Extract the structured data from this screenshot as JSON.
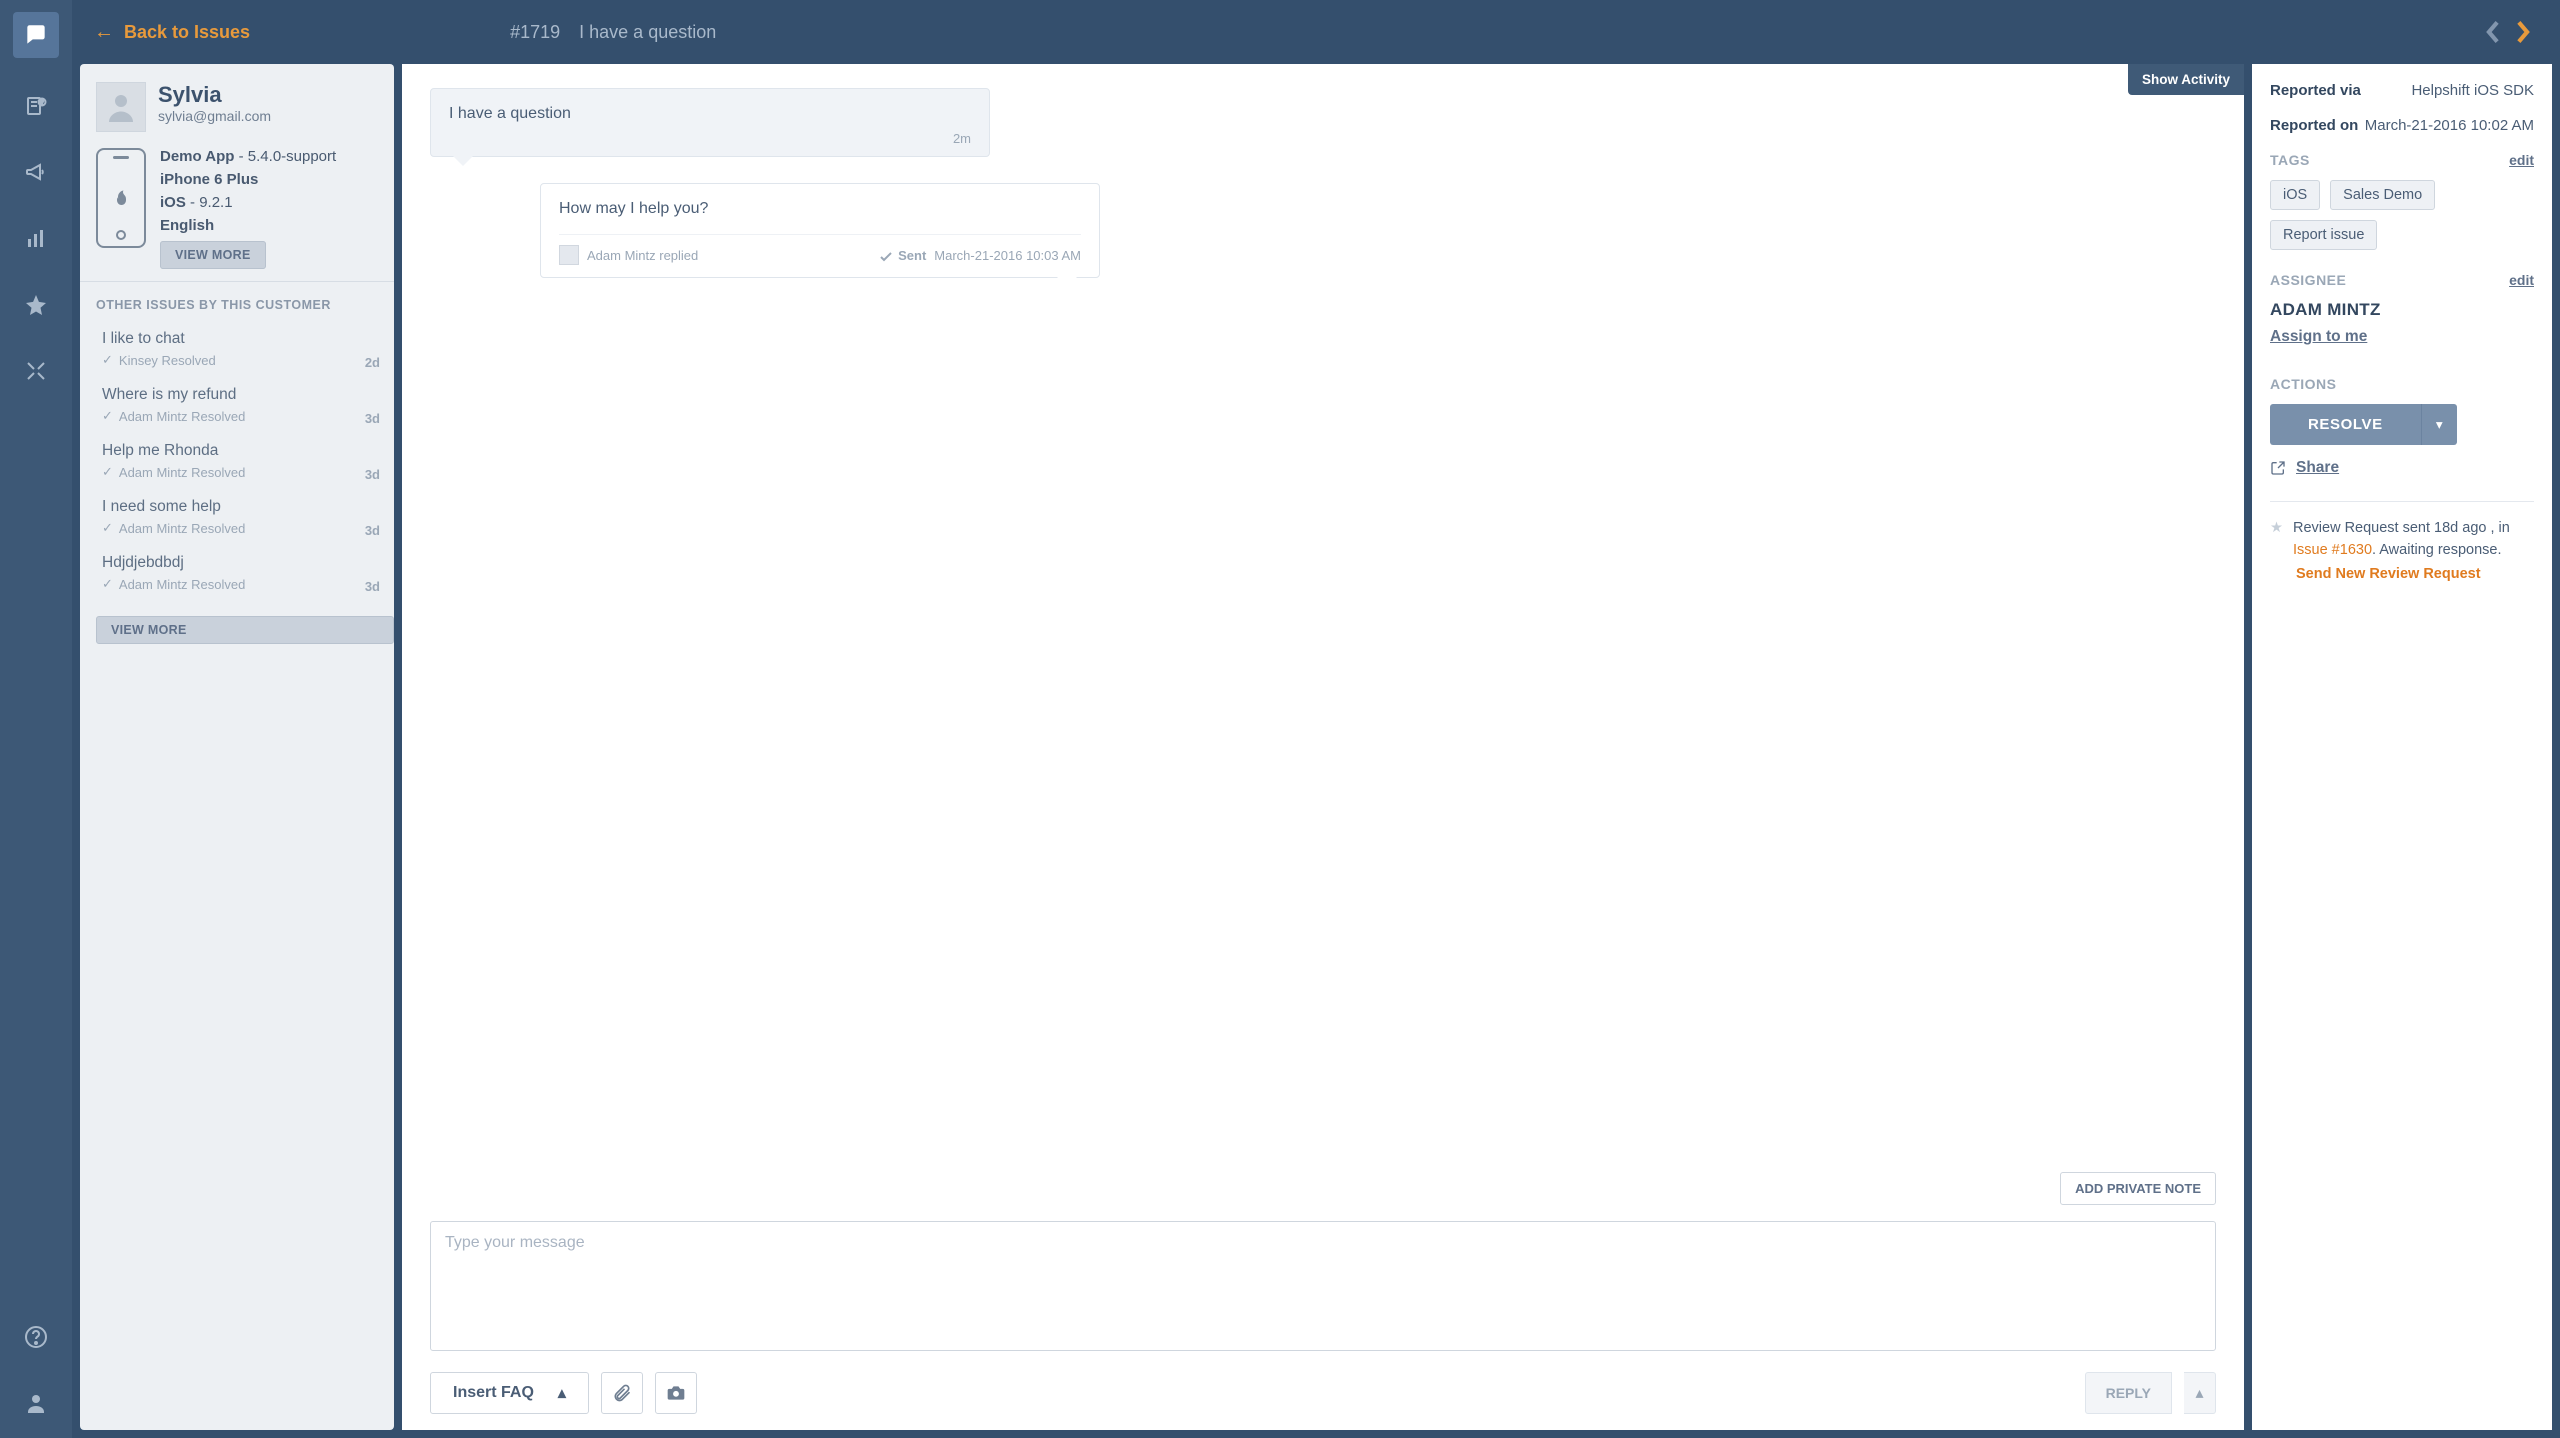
{
  "header": {
    "back_label": "Back to Issues",
    "issue_id": "#1719",
    "issue_title": "I have a question"
  },
  "customer": {
    "name": "Sylvia",
    "email": "sylvia@gmail.com",
    "app_name": "Demo App",
    "app_version": "5.4.0-support",
    "device": "iPhone 6 Plus",
    "os_name": "iOS",
    "os_version": "9.2.1",
    "language": "English",
    "view_more": "VIEW MORE"
  },
  "other_issues_label": "OTHER ISSUES BY THIS CUSTOMER",
  "other_issues": [
    {
      "title": "I like to chat",
      "meta": "Kinsey Resolved",
      "age": "2d"
    },
    {
      "title": "Where is my refund",
      "meta": "Adam Mintz Resolved",
      "age": "3d"
    },
    {
      "title": "Help me Rhonda",
      "meta": "Adam Mintz Resolved",
      "age": "3d"
    },
    {
      "title": "I need some help",
      "meta": "Adam Mintz Resolved",
      "age": "3d"
    },
    {
      "title": "Hdjdjebdbdj",
      "meta": "Adam Mintz Resolved",
      "age": "3d"
    }
  ],
  "view_more2": "VIEW MORE",
  "conversation": {
    "show_activity": "Show Activity",
    "inbound": {
      "text": "I have a question",
      "age": "2m"
    },
    "outbound": {
      "text": "How may I help you?",
      "author": "Adam Mintz replied",
      "status": "Sent",
      "timestamp": "March-21-2016 10:03 AM"
    },
    "add_private_note": "ADD PRIVATE NOTE",
    "composer_placeholder": "Type your message",
    "insert_faq": "Insert FAQ",
    "reply": "REPLY"
  },
  "details": {
    "reported_via_label": "Reported via",
    "reported_via": "Helpshift iOS SDK",
    "reported_on_label": "Reported on",
    "reported_on": "March-21-2016 10:02 AM",
    "tags_label": "TAGS",
    "edit": "edit",
    "tags": [
      "iOS",
      "Sales Demo",
      "Report issue"
    ],
    "assignee_label": "ASSIGNEE",
    "assignee": "ADAM MINTZ",
    "assign_to_me": "Assign to me",
    "actions_label": "ACTIONS",
    "resolve": "RESOLVE",
    "share": "Share",
    "review_text_1": "Review Request sent 18d ago , in ",
    "review_link": "Issue #1630",
    "review_text_2": ". Awaiting response.",
    "send_new_review": "Send New Review Request"
  }
}
